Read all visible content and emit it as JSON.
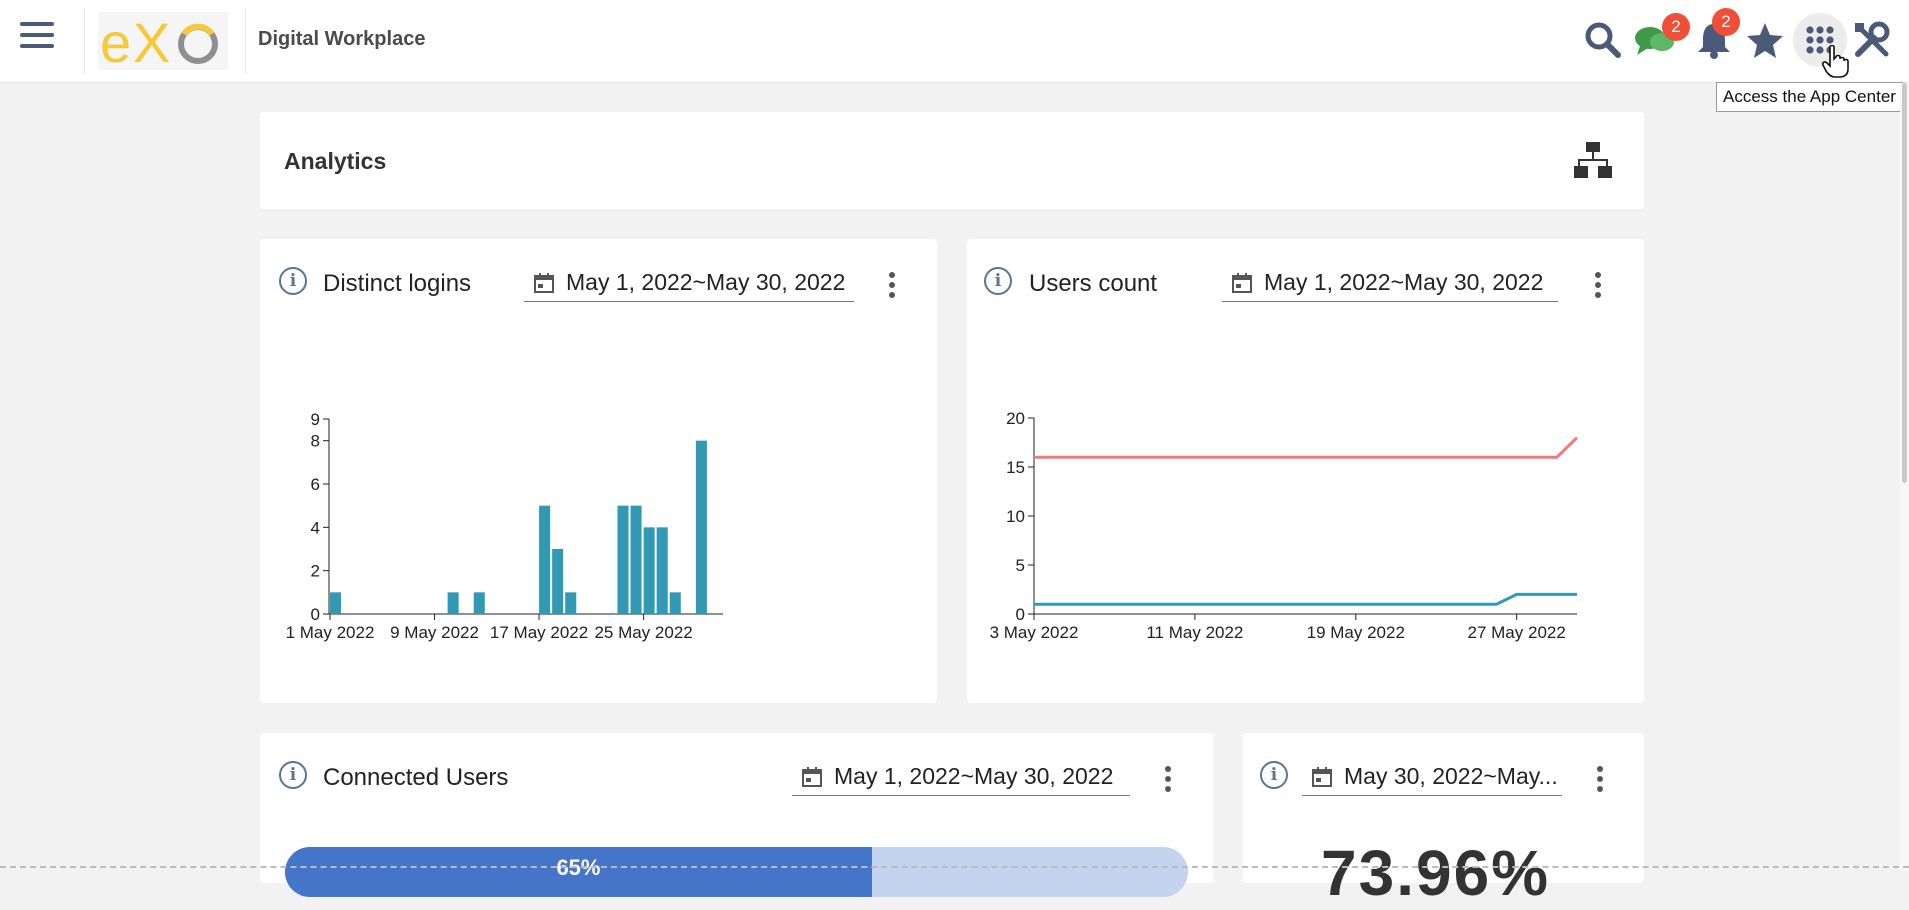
{
  "topbar": {
    "site_title": "Digital Workplace",
    "logo_text": "eXo",
    "messages_badge": "2",
    "notifications_badge": "2",
    "tooltip": "Access the App Center",
    "icons": [
      "menu-icon",
      "search-icon",
      "chat-icon",
      "bell-icon",
      "star-icon",
      "apps-grid-icon",
      "tools-icon"
    ],
    "colors": {
      "badge": "#f04e37",
      "icon": "#4a5a78",
      "logo_yellow": "#f5c93b",
      "logo_gray": "#8f8f8f"
    }
  },
  "page": {
    "title": "Analytics",
    "structure_icon": "sitemap-icon"
  },
  "widgets": {
    "logins": {
      "title": "Distinct logins",
      "date_range": "May 1, 2022~May 30, 2022"
    },
    "users": {
      "title": "Users count",
      "date_range": "May 1, 2022~May 30, 2022"
    },
    "connected": {
      "title": "Connected Users",
      "date_range": "May 1, 2022~May 30, 2022",
      "progress_pct": 0.65,
      "progress_label": "65%"
    },
    "rate": {
      "date_range": "May 30, 2022~May...",
      "value": "73.96%"
    }
  },
  "chart_data": [
    {
      "type": "bar",
      "title": "Distinct logins",
      "ylim": [
        0,
        9
      ],
      "yticks": [
        0,
        2,
        4,
        6,
        8,
        9
      ],
      "x_tick_labels": [
        "1 May 2022",
        "9 May 2022",
        "17 May 2022",
        "25 May 2022"
      ],
      "x_tick_days": [
        1,
        9,
        17,
        25
      ],
      "days": [
        1,
        2,
        3,
        4,
        5,
        6,
        7,
        8,
        9,
        10,
        11,
        12,
        13,
        14,
        15,
        16,
        17,
        18,
        19,
        20,
        21,
        22,
        23,
        24,
        25,
        26,
        27,
        28,
        29,
        30
      ],
      "values": [
        1,
        0,
        0,
        0,
        0,
        0,
        0,
        0,
        0,
        1,
        0,
        1,
        0,
        0,
        0,
        0,
        5,
        3,
        1,
        0,
        0,
        0,
        5,
        5,
        4,
        4,
        1,
        0,
        8,
        0
      ],
      "color": "#3299b5"
    },
    {
      "type": "line",
      "title": "Users count",
      "ylim": [
        0,
        20
      ],
      "yticks": [
        0,
        5,
        10,
        15,
        20
      ],
      "x_tick_labels": [
        "3 May 2022",
        "11 May 2022",
        "19 May 2022",
        "27 May 2022"
      ],
      "x_tick_days": [
        3,
        11,
        19,
        27
      ],
      "xlim": [
        3,
        30
      ],
      "series": [
        {
          "color": "#f07b78",
          "x": [
            3,
            28,
            29,
            30
          ],
          "values": [
            16,
            16,
            16,
            18
          ]
        },
        {
          "color": "#3299b5",
          "x": [
            3,
            26,
            27,
            28,
            29,
            30
          ],
          "values": [
            1,
            1,
            2,
            2,
            2,
            2
          ]
        }
      ]
    }
  ]
}
